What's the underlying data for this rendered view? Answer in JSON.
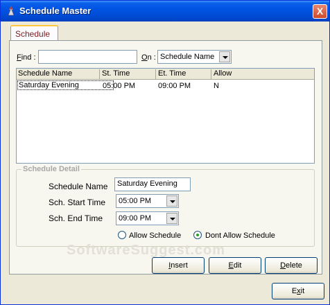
{
  "window": {
    "title": "Schedule Master",
    "close_label": "X"
  },
  "tabs": [
    {
      "label": "Schedule"
    }
  ],
  "search": {
    "find_label": "Find :",
    "find_key": "F",
    "find_rest": "ind :",
    "find_value": "",
    "on_key": "O",
    "on_rest": "n :",
    "on_value": "Schedule Name"
  },
  "grid": {
    "columns": [
      "Schedule Name",
      "St. Time",
      "Et. Time",
      "Allow"
    ],
    "rows": [
      [
        "Saturday Evening",
        "05:00 PM",
        "09:00 PM",
        "N"
      ]
    ]
  },
  "detail": {
    "legend": "Schedule Detail",
    "name_label": "Schedule Name",
    "name_value": "Saturday Evening",
    "start_label": "Sch. Start Time",
    "start_value": "05:00 PM",
    "end_label": "Sch. End Time",
    "end_value": "09:00 PM",
    "radio_allow": "Allow Schedule",
    "radio_dont": "Dont Allow Schedule",
    "selected_radio": "Dont Allow Schedule"
  },
  "buttons": {
    "insert_key": "I",
    "insert_rest": "nsert",
    "edit_key": "E",
    "edit_rest": "dit",
    "delete_key": "D",
    "delete_rest": "elete",
    "exit_key": "x",
    "exit_pre": "E",
    "exit_post": "it"
  },
  "watermark": "SoftwareSuggest.com",
  "colors": {
    "titlebar": "#0054e3",
    "tab_accent": "#ffc83c",
    "legend": "#a8a8a8"
  }
}
